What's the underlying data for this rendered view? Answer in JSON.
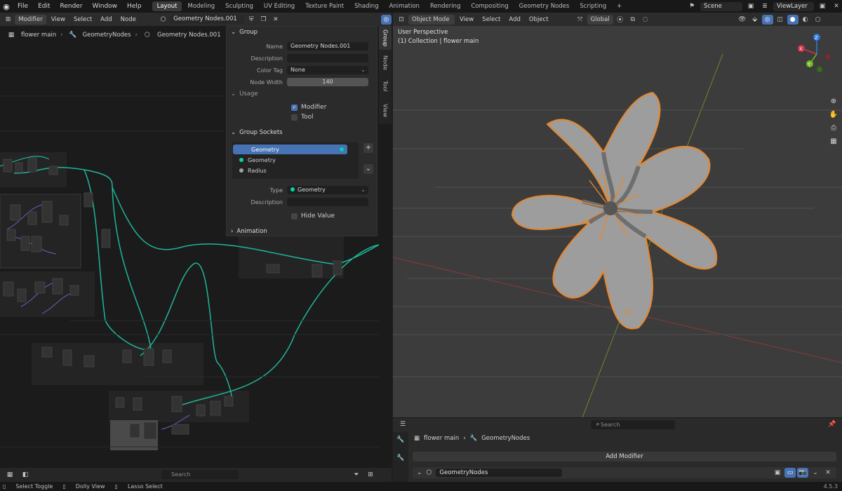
{
  "menubar": {
    "items": [
      "File",
      "Edit",
      "Render",
      "Window",
      "Help"
    ],
    "workspaces": [
      "Layout",
      "Modeling",
      "Sculpting",
      "UV Editing",
      "Texture Paint",
      "Shading",
      "Animation",
      "Rendering",
      "Compositing",
      "Geometry Nodes",
      "Scripting"
    ],
    "active_workspace": "Layout",
    "scene": "Scene",
    "view_layer": "ViewLayer"
  },
  "node_editor": {
    "header": {
      "mode": "Modifier",
      "menus": [
        "View",
        "Select",
        "Add",
        "Node"
      ],
      "node_group": "Geometry Nodes.001"
    },
    "breadcrumb": [
      "flower main",
      "GeometryNodes",
      "Geometry Nodes.001"
    ],
    "footer": {
      "search_placeholder": "Search"
    }
  },
  "npanel": {
    "group_title": "Group",
    "name_label": "Name",
    "name_value": "Geometry Nodes.001",
    "description_label": "Description",
    "color_tag_label": "Color Tag",
    "color_tag_value": "None",
    "node_width_label": "Node Width",
    "node_width_value": "140",
    "usage_title": "Usage",
    "usage_modifier": "Modifier",
    "usage_tool": "Tool",
    "sockets_title": "Group Sockets",
    "sockets": [
      {
        "name": "Geometry",
        "color": "#00d6a3",
        "selected": true
      },
      {
        "name": "Geometry",
        "color": "#00d6a3",
        "selected": false
      },
      {
        "name": "Radius",
        "color": "#a1a1a1",
        "selected": false
      }
    ],
    "type_label": "Type",
    "type_value": "Geometry",
    "socket_description_label": "Description",
    "hide_value_label": "Hide Value",
    "animation_title": "Animation",
    "tabs": [
      "Group",
      "Node",
      "Tool",
      "View"
    ]
  },
  "viewport": {
    "header": {
      "mode": "Object Mode",
      "menus": [
        "View",
        "Select",
        "Add",
        "Object"
      ],
      "orientation": "Global"
    },
    "perspective": "User Perspective",
    "collection": "(1) Collection | flower main",
    "accent": "#e8862a"
  },
  "properties": {
    "search_placeholder": "Search",
    "breadcrumb": [
      "flower main",
      "GeometryNodes"
    ],
    "add_modifier": "Add Modifier",
    "modifier_name": "GeometryNodes"
  },
  "statusbar": {
    "select_toggle": "Select Toggle",
    "dolly_view": "Dolly View",
    "lasso_select": "Lasso Select",
    "version": "4.5.3"
  }
}
